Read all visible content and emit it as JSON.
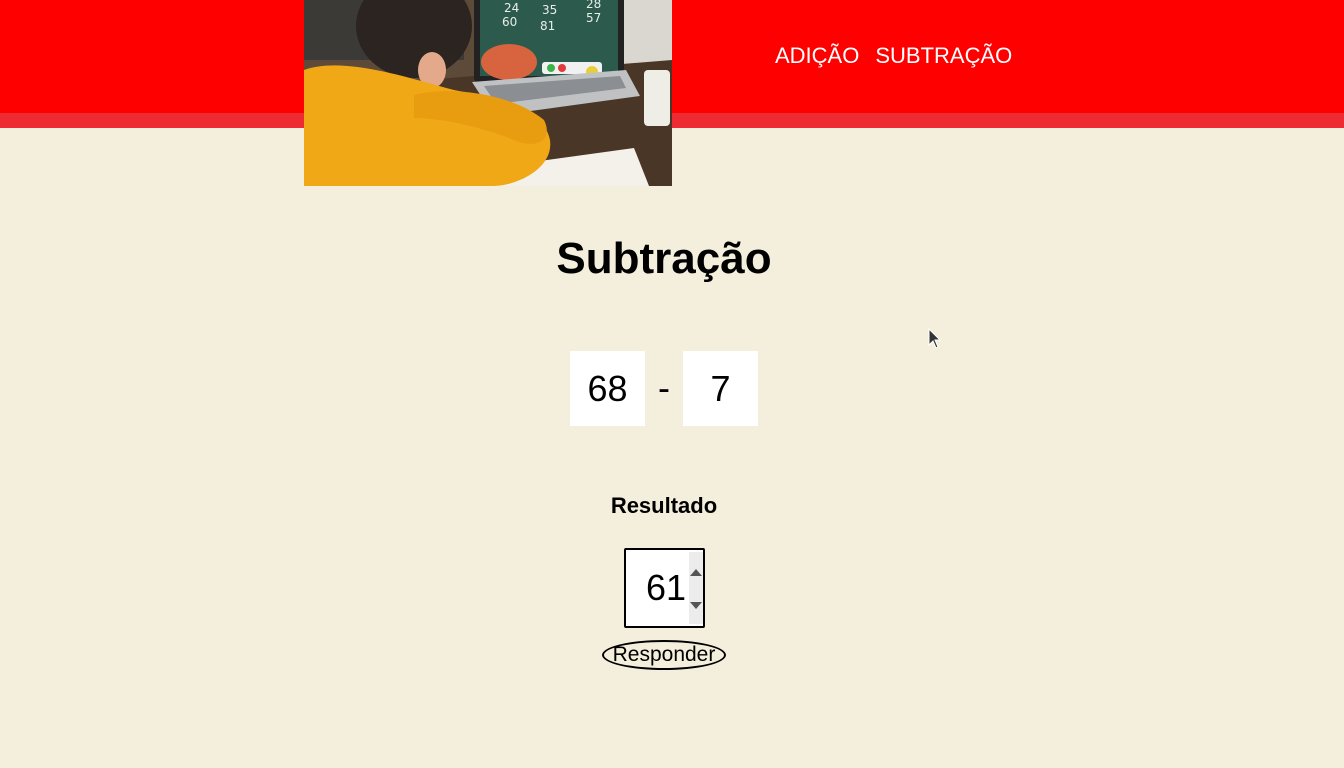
{
  "nav": {
    "items": [
      {
        "label": "ADIÇÃO"
      },
      {
        "label": "SUBTRAÇÃO"
      }
    ]
  },
  "page": {
    "title": "Subtração"
  },
  "problem": {
    "operand_a": "68",
    "operator": "-",
    "operand_b": "7"
  },
  "result": {
    "label": "Resultado",
    "value": "61"
  },
  "actions": {
    "respond_label": "Responder"
  },
  "colors": {
    "header": "#ff0000",
    "header_stripe": "#ee2b33",
    "background": "#f4efdc"
  }
}
